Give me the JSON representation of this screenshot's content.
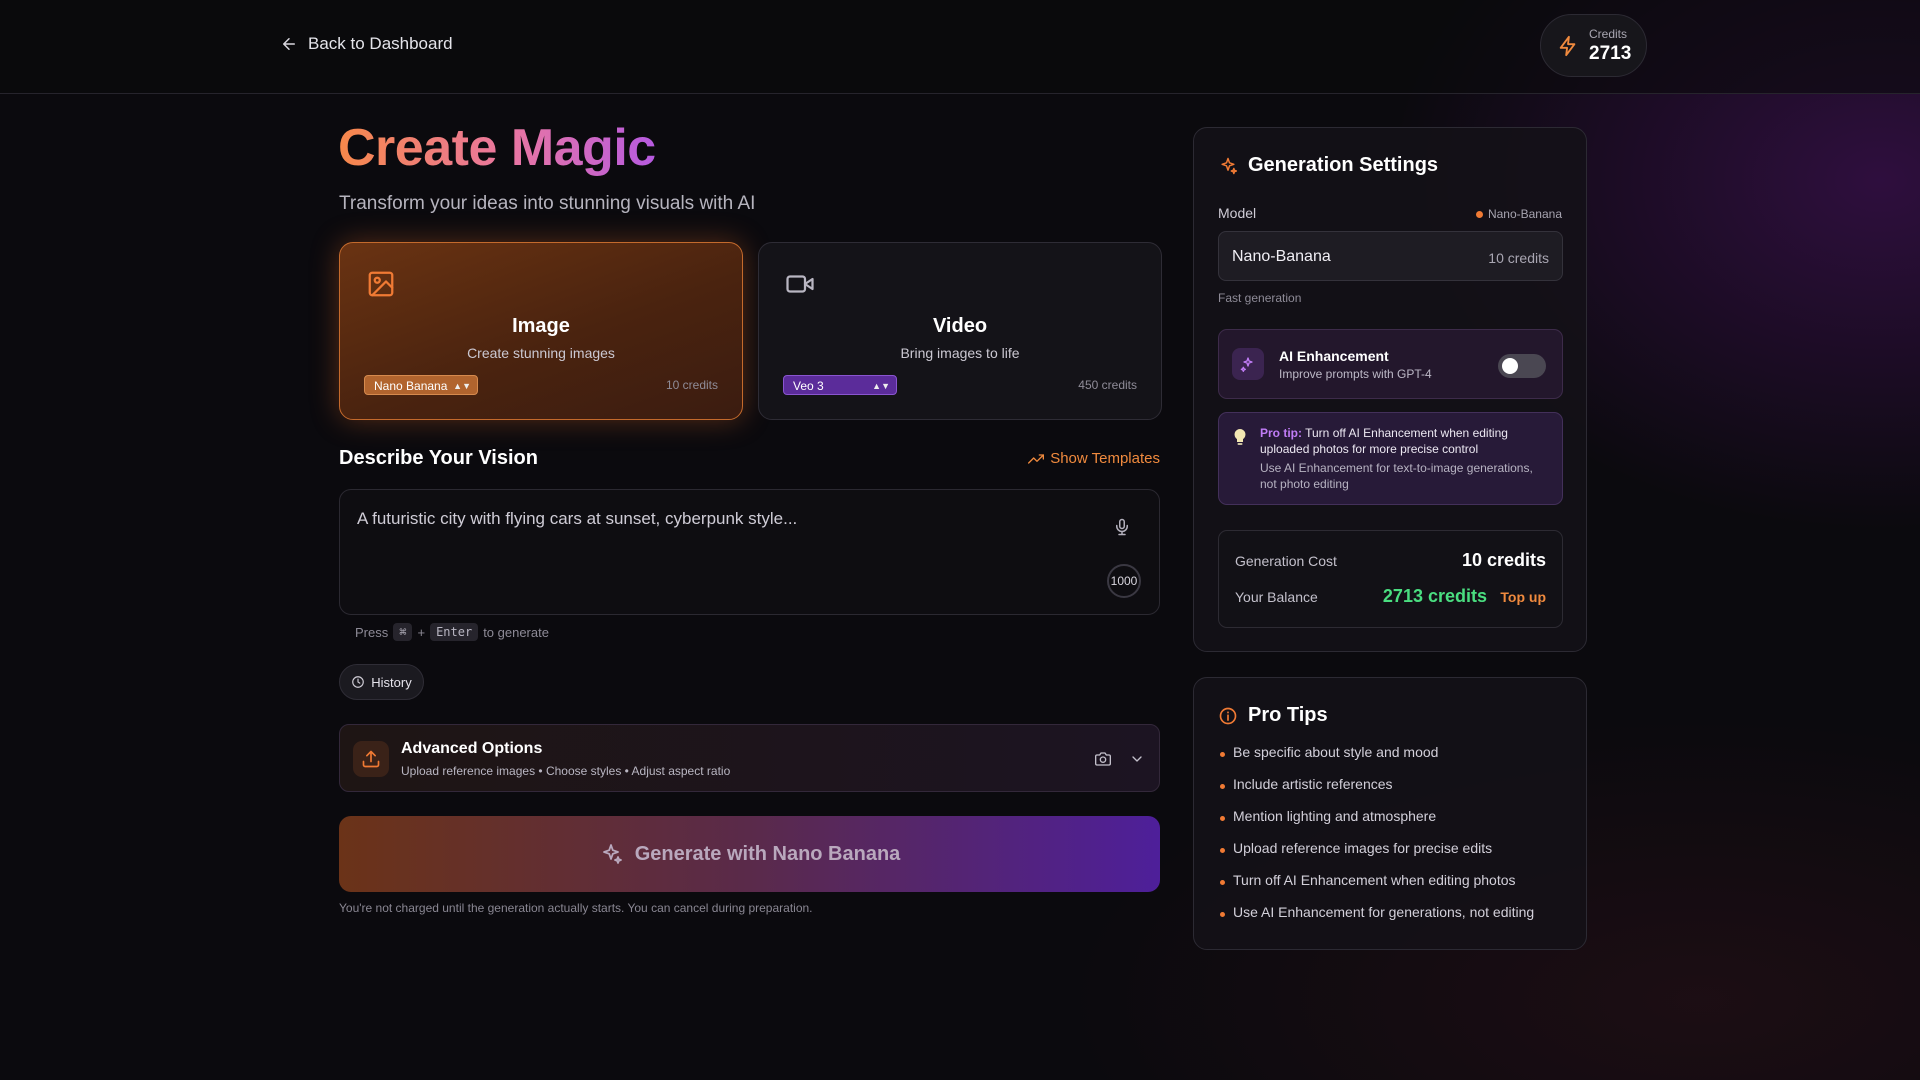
{
  "header": {
    "back_label": "Back to Dashboard",
    "credits_label": "Credits",
    "credits_value": "2713"
  },
  "hero": {
    "title": "Create Magic",
    "subtitle": "Transform your ideas into stunning visuals with AI"
  },
  "modes": [
    {
      "name": "Image",
      "description": "Create stunning images",
      "model": "Nano Banana",
      "cost": "10 credits",
      "icon": "image-icon",
      "active": true
    },
    {
      "name": "Video",
      "description": "Bring images to life",
      "model": "Veo 3",
      "cost": "450 credits",
      "icon": "video-camera-icon",
      "active": false
    }
  ],
  "vision": {
    "title": "Describe Your Vision",
    "templates_label": "Show Templates",
    "placeholder": "A futuristic city with flying cars at sunset, cyberpunk style...",
    "char_counter": "1000",
    "hint_press": "Press",
    "hint_key1": "⌘",
    "hint_plus": "+",
    "hint_key2": "Enter",
    "hint_suffix": "to generate"
  },
  "history_label": "History",
  "advanced": {
    "title": "Advanced Options",
    "subtitle": "Upload reference images • Choose styles • Adjust aspect ratio"
  },
  "generate": {
    "label": "Generate with Nano Banana",
    "disclaimer": "You're not charged until the generation actually starts. You can cancel during preparation."
  },
  "settings": {
    "title": "Generation Settings",
    "model_label": "Model",
    "model_tag": "Nano-Banana",
    "model_name": "Nano-Banana",
    "model_cost": "10 credits",
    "model_speed": "Fast generation",
    "enhancement_title": "AI Enhancement",
    "enhancement_desc": "Improve prompts with GPT-4",
    "enhancement_enabled": false,
    "protip_bold": "Pro tip:",
    "protip_text": "Turn off AI Enhancement when editing uploaded photos for more precise control",
    "protip_secondary": "Use AI Enhancement for text-to-image generations, not photo editing",
    "cost_label": "Generation Cost",
    "cost_value": "10 credits",
    "balance_label": "Your Balance",
    "balance_value": "2713 credits",
    "topup_label": "Top up"
  },
  "tips": {
    "title": "Pro Tips",
    "items": [
      "Be specific about style and mood",
      "Include artistic references",
      "Mention lighting and atmosphere",
      "Upload reference images for precise edits",
      "Turn off AI Enhancement when editing photos",
      "Use AI Enhancement for generations, not editing"
    ]
  },
  "colors": {
    "accent_orange": "#f08a3e",
    "accent_purple": "#b65ae0",
    "balance_green": "#4ade80"
  }
}
